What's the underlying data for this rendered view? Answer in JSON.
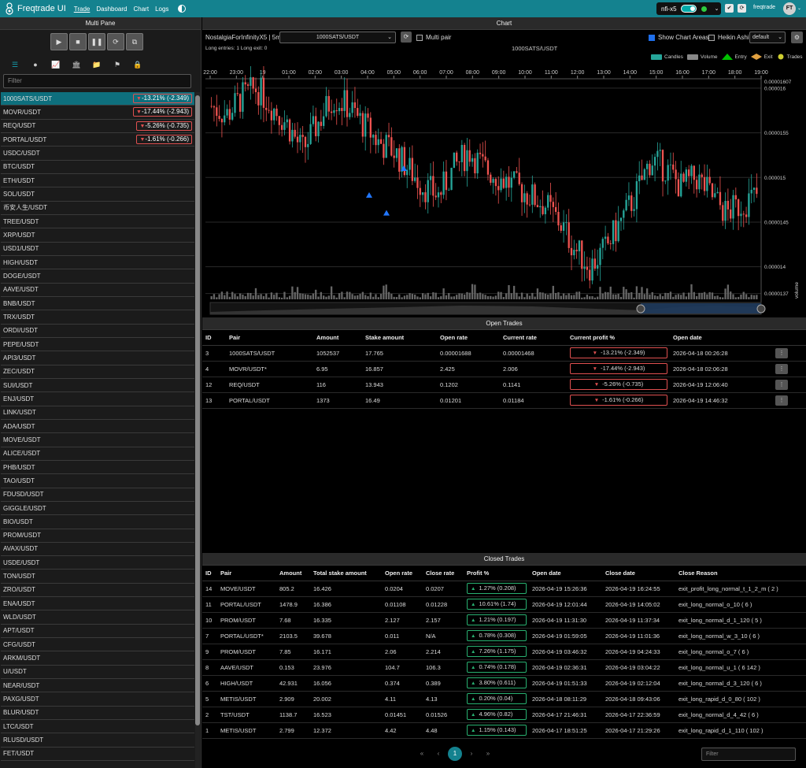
{
  "app": {
    "title": "Freqtrade UI"
  },
  "nav": {
    "items": [
      "Trade",
      "Dashboard",
      "Chart",
      "Logs"
    ]
  },
  "bot": {
    "name": "nfi-x5"
  },
  "user": {
    "name": "freqtrade",
    "initials": "FT"
  },
  "left": {
    "title": "Multi Pane",
    "filter_placeholder": "Filter",
    "pairs": [
      {
        "pair": "1000SATS/USDT",
        "profit": "-13.21% (-2.349)"
      },
      {
        "pair": "MOVR/USDT",
        "profit": "-17.44% (-2.943)"
      },
      {
        "pair": "REQ/USDT",
        "profit": "-5.26% (-0.735)"
      },
      {
        "pair": "PORTAL/USDT",
        "profit": "-1.61% (-0.266)"
      },
      {
        "pair": "USDC/USDT",
        "profit": ""
      },
      {
        "pair": "BTC/USDT",
        "profit": ""
      },
      {
        "pair": "ETH/USDT",
        "profit": ""
      },
      {
        "pair": "SOL/USDT",
        "profit": ""
      },
      {
        "pair": "币安人生/USDT",
        "profit": ""
      },
      {
        "pair": "TREE/USDT",
        "profit": ""
      },
      {
        "pair": "XRP/USDT",
        "profit": ""
      },
      {
        "pair": "USD1/USDT",
        "profit": ""
      },
      {
        "pair": "HIGH/USDT",
        "profit": ""
      },
      {
        "pair": "DOGE/USDT",
        "profit": ""
      },
      {
        "pair": "AAVE/USDT",
        "profit": ""
      },
      {
        "pair": "BNB/USDT",
        "profit": ""
      },
      {
        "pair": "TRX/USDT",
        "profit": ""
      },
      {
        "pair": "ORDI/USDT",
        "profit": ""
      },
      {
        "pair": "PEPE/USDT",
        "profit": ""
      },
      {
        "pair": "API3/USDT",
        "profit": ""
      },
      {
        "pair": "ZEC/USDT",
        "profit": ""
      },
      {
        "pair": "SUI/USDT",
        "profit": ""
      },
      {
        "pair": "ENJ/USDT",
        "profit": ""
      },
      {
        "pair": "LINK/USDT",
        "profit": ""
      },
      {
        "pair": "ADA/USDT",
        "profit": ""
      },
      {
        "pair": "MOVE/USDT",
        "profit": ""
      },
      {
        "pair": "ALICE/USDT",
        "profit": ""
      },
      {
        "pair": "PHB/USDT",
        "profit": ""
      },
      {
        "pair": "TAO/USDT",
        "profit": ""
      },
      {
        "pair": "FDUSD/USDT",
        "profit": ""
      },
      {
        "pair": "GIGGLE/USDT",
        "profit": ""
      },
      {
        "pair": "BIO/USDT",
        "profit": ""
      },
      {
        "pair": "PROM/USDT",
        "profit": ""
      },
      {
        "pair": "AVAX/USDT",
        "profit": ""
      },
      {
        "pair": "USDE/USDT",
        "profit": ""
      },
      {
        "pair": "TON/USDT",
        "profit": ""
      },
      {
        "pair": "ZRO/USDT",
        "profit": ""
      },
      {
        "pair": "ENA/USDT",
        "profit": ""
      },
      {
        "pair": "WLD/USDT",
        "profit": ""
      },
      {
        "pair": "APT/USDT",
        "profit": ""
      },
      {
        "pair": "CFG/USDT",
        "profit": ""
      },
      {
        "pair": "ARKM/USDT",
        "profit": ""
      },
      {
        "pair": "U/USDT",
        "profit": ""
      },
      {
        "pair": "NEAR/USDT",
        "profit": ""
      },
      {
        "pair": "PAXG/USDT",
        "profit": ""
      },
      {
        "pair": "BLUR/USDT",
        "profit": ""
      },
      {
        "pair": "LTC/USDT",
        "profit": ""
      },
      {
        "pair": "RLUSD/USDT",
        "profit": ""
      },
      {
        "pair": "FET/USDT",
        "profit": ""
      }
    ]
  },
  "chart": {
    "header": "Chart",
    "strategy": "NostalgiaForInfinityX5 | 5m",
    "pair_select": "1000SATS/USDT",
    "multi_pair": "Multi pair",
    "long_info": "Long entries: 1   Long exit: 0",
    "chart_title": "1000SATS/USDT",
    "show_areas": "Show Chart Areas",
    "heikin": "Heikin Ashi",
    "layout_select": "default",
    "legend": [
      "Candles",
      "Volume",
      "Entry",
      "Exit",
      "Trades"
    ],
    "colors": {
      "up": "#26a69a",
      "down": "#ef5350",
      "entry": "#00c000",
      "exit": "#e0a040",
      "trades": "#cfcf30"
    },
    "volume_label": "volume"
  },
  "chart_data": {
    "type": "candlestick",
    "x_ticks": [
      "22:00",
      "23:00",
      "19",
      "01:00",
      "02:00",
      "03:00",
      "04:00",
      "05:00",
      "06:00",
      "07:00",
      "08:00",
      "09:00",
      "10:00",
      "11:00",
      "12:00",
      "13:00",
      "14:00",
      "15:00",
      "16:00",
      "17:00",
      "18:00",
      "19:00"
    ],
    "y_ticks": [
      "0.000016",
      "0.0000155",
      "0.000015",
      "0.0000145",
      "0.000014",
      "0.0000137"
    ],
    "y_range": [
      1.36e-05,
      1.607e-05
    ],
    "last_price": "0.00001607",
    "close_path": [
      1.58e-05,
      1.57e-05,
      1.59e-05,
      1.6e-05,
      1.58e-05,
      1.56e-05,
      1.53e-05,
      1.56e-05,
      1.59e-05,
      1.58e-05,
      1.56e-05,
      1.54e-05,
      1.53e-05,
      1.51e-05,
      1.49e-05,
      1.48e-05,
      1.51e-05,
      1.53e-05,
      1.51e-05,
      1.5e-05,
      1.49e-05,
      1.48e-05,
      1.47e-05,
      1.45e-05,
      1.42e-05,
      1.4e-05,
      1.42e-05,
      1.45e-05,
      1.48e-05,
      1.52e-05,
      1.51e-05,
      1.49e-05,
      1.5e-05,
      1.48e-05,
      1.46e-05,
      1.47e-05,
      1.48e-05
    ]
  },
  "open_trades": {
    "title": "Open Trades",
    "columns": [
      "ID",
      "Pair",
      "Amount",
      "Stake amount",
      "Open rate",
      "Current rate",
      "Current profit %",
      "Open date"
    ],
    "rows": [
      {
        "id": "3",
        "pair": "1000SATS/USDT",
        "amount": "1052537",
        "stake": "17.765",
        "open_rate": "0.00001688",
        "cur_rate": "0.00001468",
        "profit": "-13.21% (-2.349)",
        "open_date": "2026-04-18 00:26:28"
      },
      {
        "id": "4",
        "pair": "MOVR/USDT*",
        "amount": "6.95",
        "stake": "16.857",
        "open_rate": "2.425",
        "cur_rate": "2.006",
        "profit": "-17.44% (-2.943)",
        "open_date": "2026-04-18 02:06:28"
      },
      {
        "id": "12",
        "pair": "REQ/USDT",
        "amount": "116",
        "stake": "13.943",
        "open_rate": "0.1202",
        "cur_rate": "0.1141",
        "profit": "-5.26% (-0.735)",
        "open_date": "2026-04-19 12:06:40"
      },
      {
        "id": "13",
        "pair": "PORTAL/USDT",
        "amount": "1373",
        "stake": "16.49",
        "open_rate": "0.01201",
        "cur_rate": "0.01184",
        "profit": "-1.61% (-0.266)",
        "open_date": "2026-04-19 14:46:32"
      }
    ]
  },
  "closed_trades": {
    "title": "Closed Trades",
    "columns": [
      "ID",
      "Pair",
      "Amount",
      "Total stake amount",
      "Open rate",
      "Close rate",
      "Profit %",
      "Open date",
      "Close date",
      "Close Reason"
    ],
    "rows": [
      {
        "id": "14",
        "pair": "MOVE/USDT",
        "amount": "805.2",
        "stake": "16.426",
        "open_rate": "0.0204",
        "close_rate": "0.0207",
        "profit": "1.27% (0.208)",
        "open_date": "2026-04-19 15:26:36",
        "close_date": "2026-04-19 16:24:55",
        "reason": "exit_profit_long_normal_t_1_2_m ( 2 )"
      },
      {
        "id": "11",
        "pair": "PORTAL/USDT",
        "amount": "1478.9",
        "stake": "16.386",
        "open_rate": "0.01108",
        "close_rate": "0.01228",
        "profit": "10.61% (1.74)",
        "open_date": "2026-04-19 12:01:44",
        "close_date": "2026-04-19 14:05:02",
        "reason": "exit_long_normal_o_10 ( 6 )"
      },
      {
        "id": "10",
        "pair": "PROM/USDT",
        "amount": "7.68",
        "stake": "16.335",
        "open_rate": "2.127",
        "close_rate": "2.157",
        "profit": "1.21% (0.197)",
        "open_date": "2026-04-19 11:31:30",
        "close_date": "2026-04-19 11:37:34",
        "reason": "exit_long_normal_d_1_120 ( 5 )"
      },
      {
        "id": "7",
        "pair": "PORTAL/USDT*",
        "amount": "2103.5",
        "stake": "39.678",
        "open_rate": "0.011",
        "close_rate": "N/A",
        "profit": "0.78% (0.308)",
        "open_date": "2026-04-19 01:59:05",
        "close_date": "2026-04-19 11:01:36",
        "reason": "exit_long_normal_w_3_10 ( 6 )"
      },
      {
        "id": "9",
        "pair": "PROM/USDT",
        "amount": "7.85",
        "stake": "16.171",
        "open_rate": "2.06",
        "close_rate": "2.214",
        "profit": "7.26% (1.175)",
        "open_date": "2026-04-19 03:46:32",
        "close_date": "2026-04-19 04:24:33",
        "reason": "exit_long_normal_o_7 ( 6 )"
      },
      {
        "id": "8",
        "pair": "AAVE/USDT",
        "amount": "0.153",
        "stake": "23.976",
        "open_rate": "104.7",
        "close_rate": "106.3",
        "profit": "0.74% (0.178)",
        "open_date": "2026-04-19 02:36:31",
        "close_date": "2026-04-19 03:04:22",
        "reason": "exit_long_normal_u_1 ( 6 142 )"
      },
      {
        "id": "6",
        "pair": "HIGH/USDT",
        "amount": "42.931",
        "stake": "16.056",
        "open_rate": "0.374",
        "close_rate": "0.389",
        "profit": "3.80% (0.611)",
        "open_date": "2026-04-19 01:51:33",
        "close_date": "2026-04-19 02:12:04",
        "reason": "exit_long_normal_d_3_120 ( 6 )"
      },
      {
        "id": "5",
        "pair": "METIS/USDT",
        "amount": "2.909",
        "stake": "20.002",
        "open_rate": "4.11",
        "close_rate": "4.13",
        "profit": "0.20% (0.04)",
        "open_date": "2026-04-18 08:11:29",
        "close_date": "2026-04-18 09:43:06",
        "reason": "exit_long_rapid_d_0_80 ( 102 )"
      },
      {
        "id": "2",
        "pair": "TST/USDT",
        "amount": "1138.7",
        "stake": "16.523",
        "open_rate": "0.01451",
        "close_rate": "0.01526",
        "profit": "4.96% (0.82)",
        "open_date": "2026-04-17 21:46:31",
        "close_date": "2026-04-17 22:36:59",
        "reason": "exit_long_normal_d_4_42 ( 6 )"
      },
      {
        "id": "1",
        "pair": "METIS/USDT",
        "amount": "2.799",
        "stake": "12.372",
        "open_rate": "4.42",
        "close_rate": "4.48",
        "profit": "1.15% (0.143)",
        "open_date": "2026-04-17 18:51:25",
        "close_date": "2026-04-17 21:29:26",
        "reason": "exit_long_rapid_d_1_110 ( 102 )"
      }
    ],
    "pager": {
      "current": "1"
    },
    "filter_placeholder": "Filter"
  }
}
